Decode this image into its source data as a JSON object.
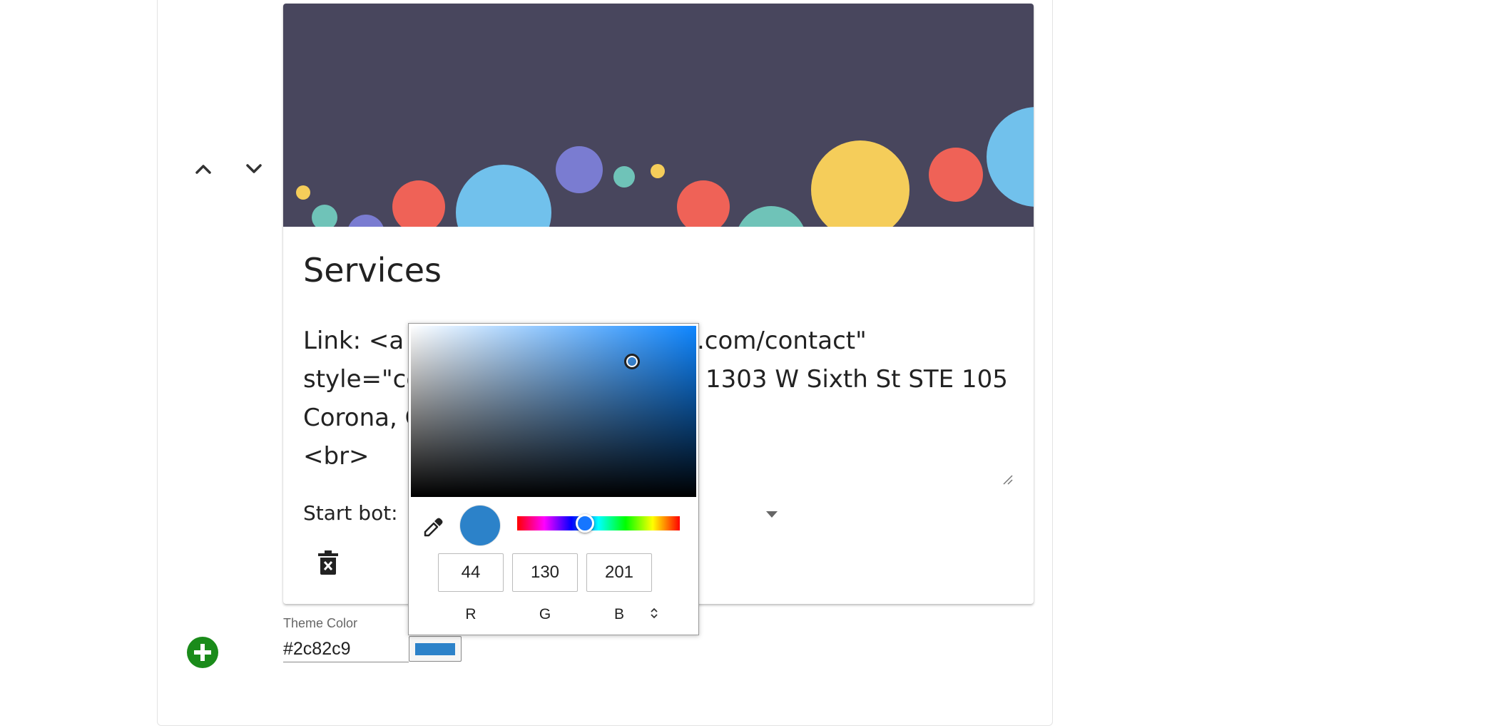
{
  "card": {
    "title": "Services",
    "body_lines": [
      "Link: <a h",
      ".com/contact\"",
      "style=\"co",
      "1303 W Sixth St STE 105",
      "Corona, C",
      "<br>"
    ],
    "start_bot_label": "Start bot:"
  },
  "theme": {
    "label": "Theme Color",
    "value": "#2c82c9",
    "swatch_color": "#2c82c9"
  },
  "picker": {
    "preview_color": "#2c82c9",
    "r": "44",
    "g": "130",
    "b": "201",
    "r_label": "R",
    "g_label": "G",
    "b_label": "B"
  },
  "colors": {
    "banner": "#48465d",
    "add_button": "#1a8b1a"
  },
  "icons": [
    "chevron-up-icon",
    "chevron-down-icon",
    "trash-icon",
    "plus-icon",
    "eyedropper-icon",
    "resize-handle-icon",
    "dropdown-caret-icon",
    "unfold-icon"
  ]
}
